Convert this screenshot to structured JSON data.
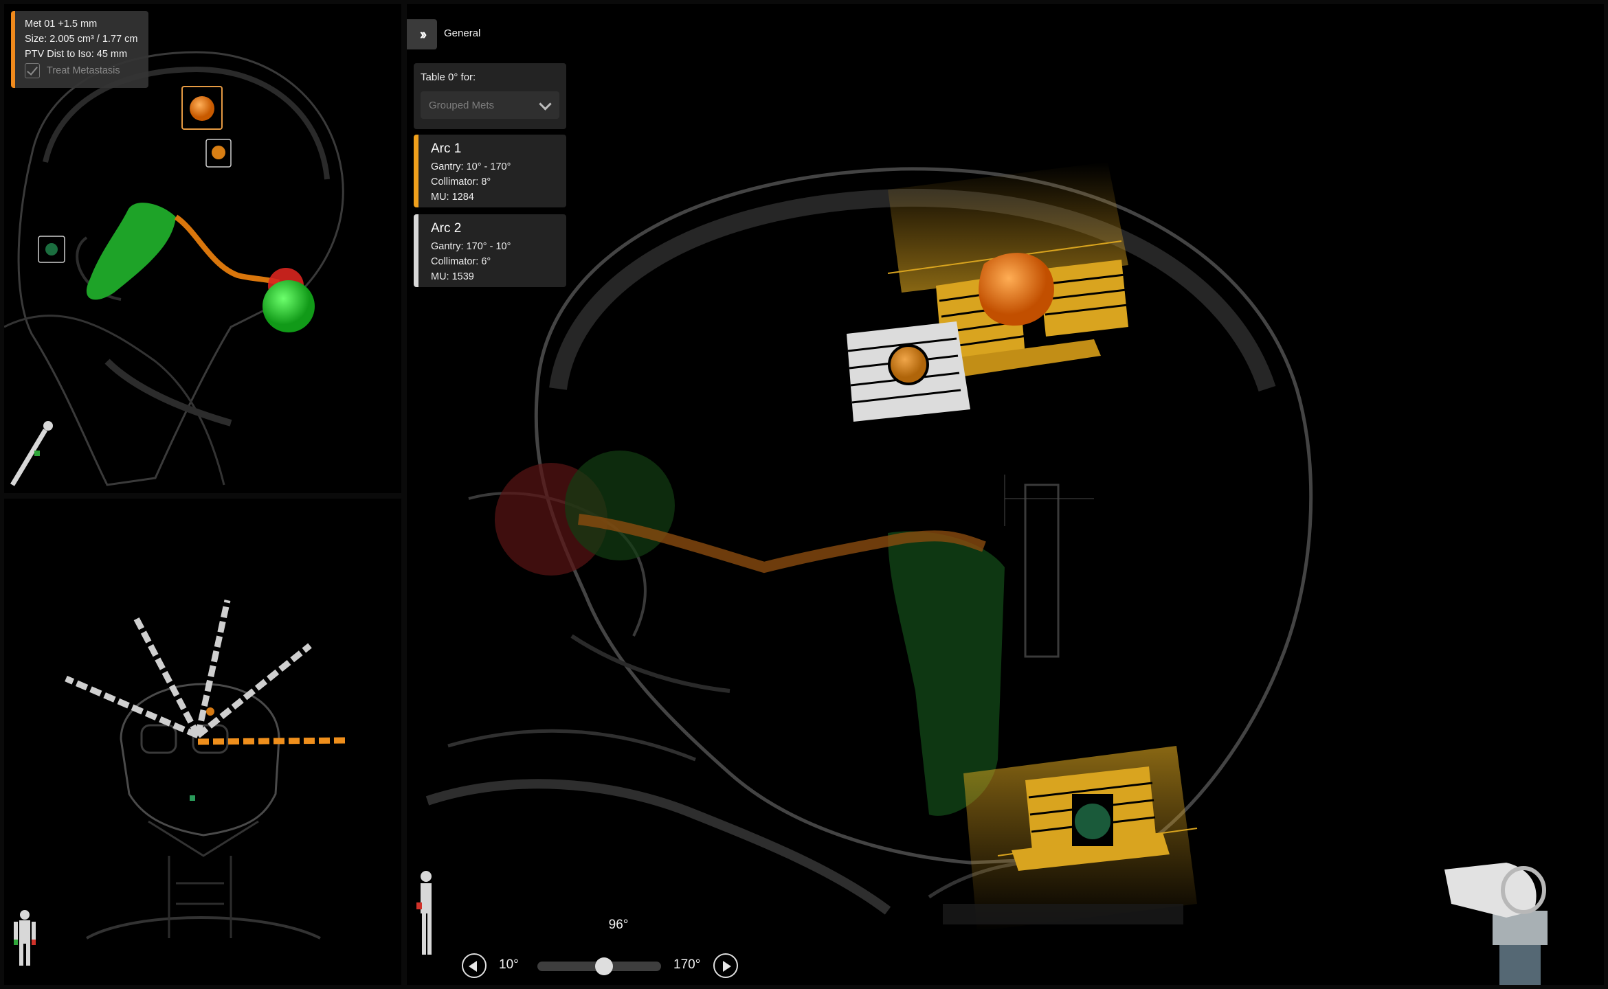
{
  "met_info": {
    "title": "Met 01 +1.5 mm",
    "size": "Size: 2.005 cm³ / 1.77 cm",
    "ptv_dist": "PTV Dist to Iso: 45 mm",
    "treat_label": "Treat Metastasis",
    "treat_checked": true,
    "accent_color": "#f08a1c"
  },
  "toolbar": {
    "expand_icon": "double-chevron-right-icon",
    "general_label": "General"
  },
  "table_panel": {
    "label": "Table 0° for:",
    "select_value": "Grouped Mets"
  },
  "arcs": [
    {
      "title": "Arc 1",
      "gantry": "Gantry: 10° - 170°",
      "collimator": "Collimator: 8°",
      "mu": "MU: 1284",
      "color": "#f0a01c"
    },
    {
      "title": "Arc 2",
      "gantry": "Gantry: 170° - 10°",
      "collimator": "Collimator: 6°",
      "mu": "MU: 1539",
      "color": "#d8d8d8"
    }
  ],
  "gantry_slider": {
    "current": "96°",
    "min_label": "10°",
    "max_label": "170°",
    "min": 10,
    "max": 170,
    "value": 96
  }
}
